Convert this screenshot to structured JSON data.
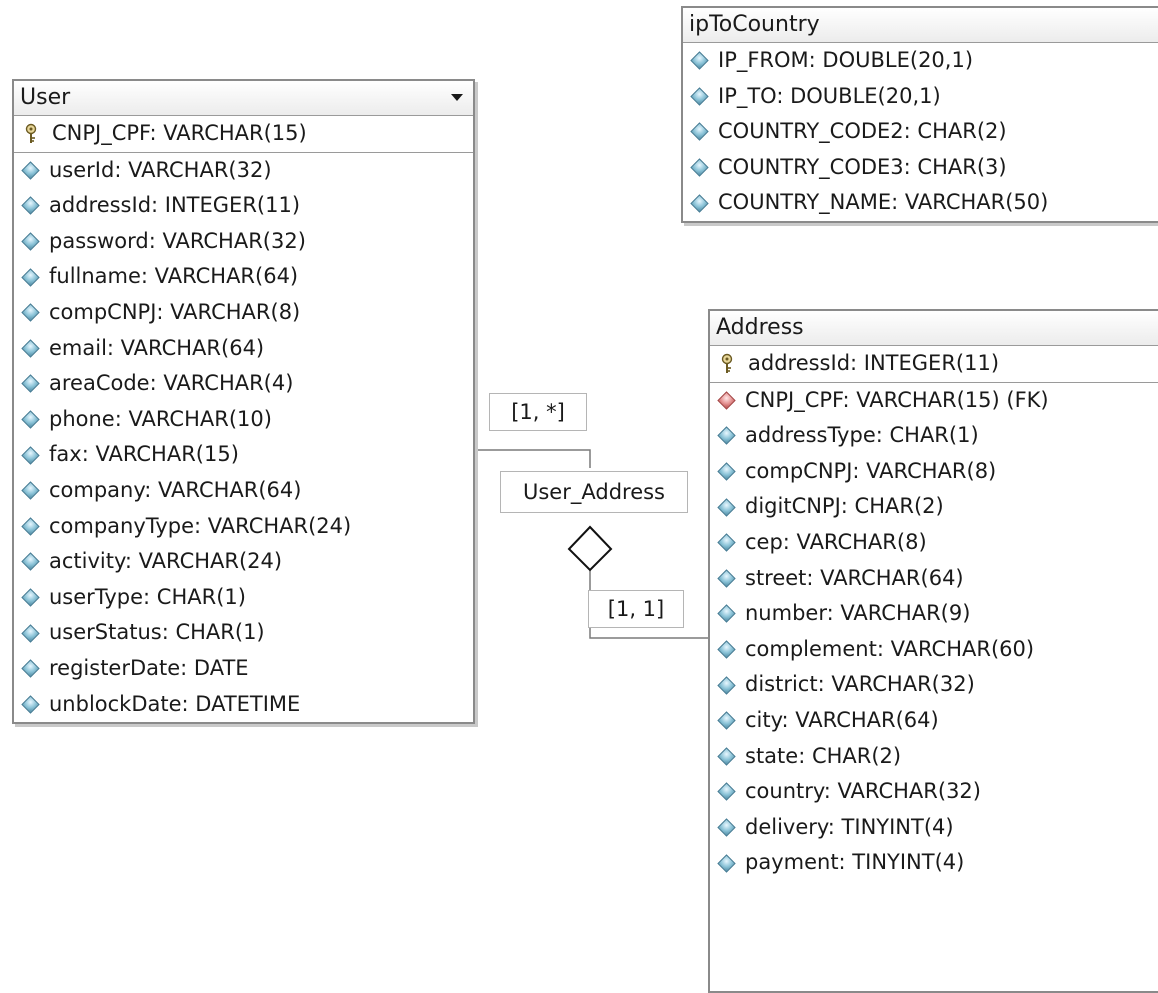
{
  "entities": {
    "ip_to_country": {
      "name": "ipToCountry",
      "attributes": [
        "IP_FROM: DOUBLE(20,1)",
        "IP_TO: DOUBLE(20,1)",
        "COUNTRY_CODE2: CHAR(2)",
        "COUNTRY_CODE3: CHAR(3)",
        "COUNTRY_NAME: VARCHAR(50)"
      ]
    },
    "user": {
      "name": "User",
      "primary_key": "CNPJ_CPF: VARCHAR(15)",
      "attributes": [
        "userId: VARCHAR(32)",
        "addressId: INTEGER(11)",
        "password: VARCHAR(32)",
        "fullname: VARCHAR(64)",
        "compCNPJ: VARCHAR(8)",
        "email: VARCHAR(64)",
        "areaCode: VARCHAR(4)",
        "phone: VARCHAR(10)",
        "fax: VARCHAR(15)",
        "company: VARCHAR(64)",
        "companyType: VARCHAR(24)",
        "activity: VARCHAR(24)",
        "userType: CHAR(1)",
        "userStatus: CHAR(1)",
        "registerDate: DATE",
        "unblockDate: DATETIME"
      ]
    },
    "address": {
      "name": "Address",
      "primary_key": "addressId: INTEGER(11)",
      "foreign_key": "CNPJ_CPF: VARCHAR(15) (FK)",
      "attributes": [
        "addressType: CHAR(1)",
        "compCNPJ: VARCHAR(8)",
        "digitCNPJ: CHAR(2)",
        "cep: VARCHAR(8)",
        "street: VARCHAR(64)",
        "number: VARCHAR(9)",
        "complement: VARCHAR(60)",
        "district: VARCHAR(32)",
        "city: VARCHAR(64)",
        "state: CHAR(2)",
        "country: VARCHAR(32)",
        "delivery: TINYINT(4)",
        "payment: TINYINT(4)"
      ]
    }
  },
  "relationship": {
    "name": "User_Address",
    "cardinality_user": "[1, *]",
    "cardinality_address": "[1, 1]"
  },
  "icons": {
    "attribute": "attribute-diamond-icon",
    "foreign_key": "foreign-key-diamond-icon",
    "primary_key": "primary-key-icon",
    "collapse": "collapse-arrow-icon",
    "aggregation": "aggregation-diamond-icon"
  },
  "colors": {
    "attribute_icon": "#8cc4d8",
    "foreign_key_icon": "#e59393",
    "border": "#8a8a8a"
  }
}
